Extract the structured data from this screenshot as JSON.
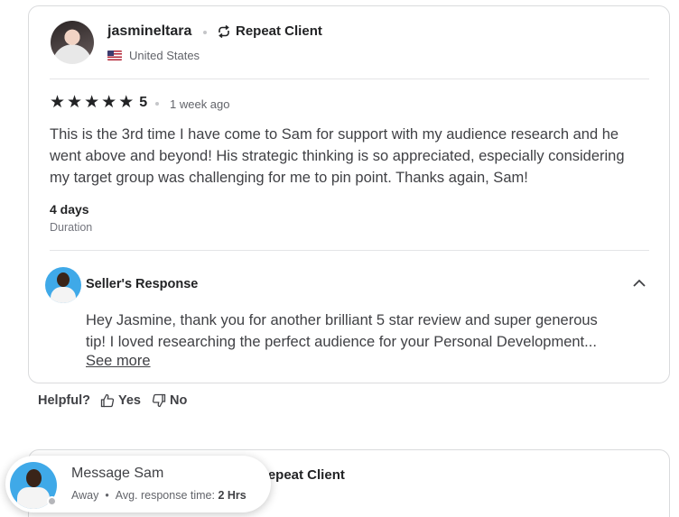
{
  "review": {
    "reviewer_name": "jasmineltara",
    "repeat_client_label": "Repeat Client",
    "country": "United States",
    "rating": "5",
    "time_ago": "1 week ago",
    "text": "This is the 3rd time I have come to Sam for support with my audience research and he went above and beyond! His strategic thinking is so appreciated, especially considering my target group was challenging for me to pin point. Thanks again, Sam!",
    "duration_value": "4 days",
    "duration_label": "Duration",
    "seller_response": {
      "title": "Seller's Response",
      "line1": "Hey Jasmine, thank you for another brilliant 5 star review and super generous",
      "line2": "tip! I loved researching the perfect audience for your Personal Development...",
      "see_more": "See more"
    }
  },
  "helpful": {
    "label": "Helpful?",
    "yes": "Yes",
    "no": "No"
  },
  "next_review": {
    "repeat_client_label": "Repeat Client"
  },
  "message_popup": {
    "title": "Message Sam",
    "status": "Away",
    "response_label": "Avg. response time:",
    "response_time": "2 Hrs"
  },
  "icons": {
    "star": "star-icon",
    "repeat": "repeat-icon",
    "flag": "us-flag-icon",
    "chevron": "chevron-up-icon",
    "thumbs_up": "thumbs-up-icon",
    "thumbs_down": "thumbs-down-icon"
  },
  "colors": {
    "text_primary": "#222325",
    "text_secondary": "#62646a",
    "border": "#dadbdd",
    "avatar_bg": "#3fa9e8"
  }
}
